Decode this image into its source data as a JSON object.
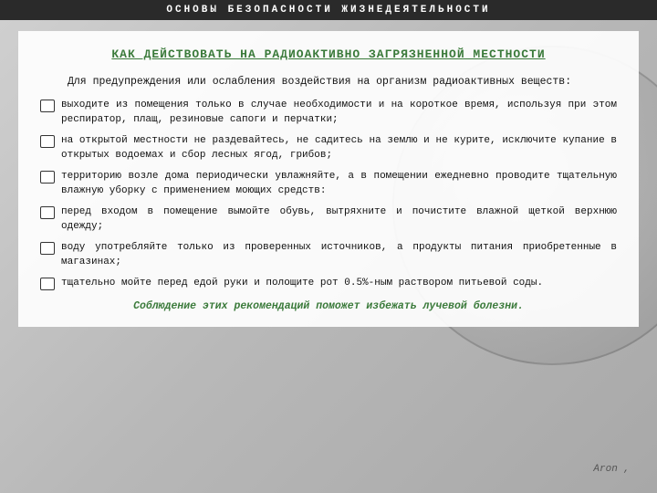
{
  "header": {
    "title": "ОСНОВЫ  БЕЗОПАСНОСТИ   ЖИЗНЕДЕЯТЕЛЬНОСТИ"
  },
  "main": {
    "title": "КАК ДЕЙСТВОВАТЬ НА РАДИОАКТИВНО ЗАГРЯЗНЕННОЙ МЕСТНОСТИ",
    "intro": "Для  предупреждения  или  ослабления  воздействия  на  организм радиоактивных веществ:",
    "bullets": [
      "выходите из помещения только в случае необходимости и на короткое время, используя при этом респиратор, плащ, резиновые сапоги и перчатки;",
      "на открытой местности не раздевайтесь, не садитесь на землю и не курите, исключите купание в открытых водоемах и сбор лесных ягод, грибов;",
      "территорию возле дома периодически увлажняйте, а в помещении ежедневно проводите тщательную влажную уборку с применением моющих средств:",
      "перед входом в помещение вымойте обувь, вытряхните и почистите влажной щеткой верхнюю одежду;",
      "воду употребляйте только из проверенных источников, а продукты питания  приобретенные в магазинах;",
      "тщательно мойте перед едой руки и полощите рот 0.5%-ным раствором питьевой соды."
    ],
    "footer": "Соблюдение этих рекомендаций поможет избежать лучевой болезни."
  },
  "author": "Aron ,"
}
